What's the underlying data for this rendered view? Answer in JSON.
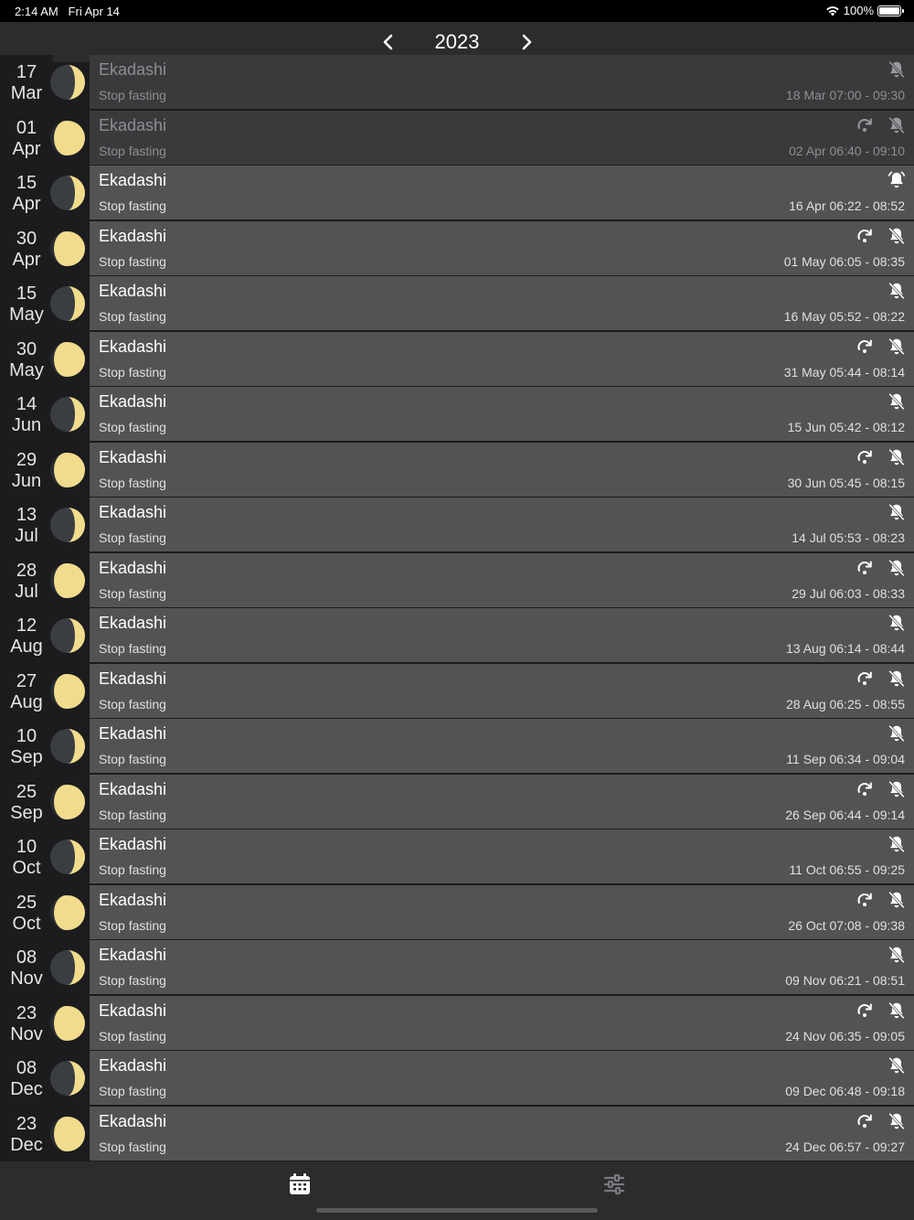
{
  "status_bar": {
    "time": "2:14 AM",
    "date": "Fri Apr 14",
    "battery": "100%"
  },
  "nav": {
    "year": "2023",
    "prev_icon": "chevron-left-icon",
    "next_icon": "chevron-right-icon"
  },
  "events": [
    {
      "day": "17",
      "month": "Mar",
      "title": "Ekadashi",
      "subtitle": "Stop fasting",
      "time": "18 Mar 07:00 - 09:30",
      "moon": "waxing",
      "past": true,
      "repeat": false,
      "bell": "off"
    },
    {
      "day": "01",
      "month": "Apr",
      "title": "Ekadashi",
      "subtitle": "Stop fasting",
      "time": "02 Apr 06:40 - 09:10",
      "moon": "full",
      "past": true,
      "repeat": true,
      "bell": "off"
    },
    {
      "day": "15",
      "month": "Apr",
      "title": "Ekadashi",
      "subtitle": "Stop fasting",
      "time": "16 Apr 06:22 - 08:52",
      "moon": "waxing",
      "past": false,
      "repeat": false,
      "bell": "on"
    },
    {
      "day": "30",
      "month": "Apr",
      "title": "Ekadashi",
      "subtitle": "Stop fasting",
      "time": "01 May 06:05 - 08:35",
      "moon": "full",
      "past": false,
      "repeat": true,
      "bell": "off"
    },
    {
      "day": "15",
      "month": "May",
      "title": "Ekadashi",
      "subtitle": "Stop fasting",
      "time": "16 May 05:52 - 08:22",
      "moon": "waxing",
      "past": false,
      "repeat": false,
      "bell": "off"
    },
    {
      "day": "30",
      "month": "May",
      "title": "Ekadashi",
      "subtitle": "Stop fasting",
      "time": "31 May 05:44 - 08:14",
      "moon": "full",
      "past": false,
      "repeat": true,
      "bell": "off"
    },
    {
      "day": "14",
      "month": "Jun",
      "title": "Ekadashi",
      "subtitle": "Stop fasting",
      "time": "15 Jun 05:42 - 08:12",
      "moon": "waxing",
      "past": false,
      "repeat": false,
      "bell": "off"
    },
    {
      "day": "29",
      "month": "Jun",
      "title": "Ekadashi",
      "subtitle": "Stop fasting",
      "time": "30 Jun 05:45 - 08:15",
      "moon": "full",
      "past": false,
      "repeat": true,
      "bell": "off"
    },
    {
      "day": "13",
      "month": "Jul",
      "title": "Ekadashi",
      "subtitle": "Stop fasting",
      "time": "14 Jul 05:53 - 08:23",
      "moon": "waxing",
      "past": false,
      "repeat": false,
      "bell": "off"
    },
    {
      "day": "28",
      "month": "Jul",
      "title": "Ekadashi",
      "subtitle": "Stop fasting",
      "time": "29 Jul 06:03 - 08:33",
      "moon": "full",
      "past": false,
      "repeat": true,
      "bell": "off"
    },
    {
      "day": "12",
      "month": "Aug",
      "title": "Ekadashi",
      "subtitle": "Stop fasting",
      "time": "13 Aug 06:14 - 08:44",
      "moon": "waxing",
      "past": false,
      "repeat": false,
      "bell": "off"
    },
    {
      "day": "27",
      "month": "Aug",
      "title": "Ekadashi",
      "subtitle": "Stop fasting",
      "time": "28 Aug 06:25 - 08:55",
      "moon": "full",
      "past": false,
      "repeat": true,
      "bell": "off"
    },
    {
      "day": "10",
      "month": "Sep",
      "title": "Ekadashi",
      "subtitle": "Stop fasting",
      "time": "11 Sep 06:34 - 09:04",
      "moon": "waxing",
      "past": false,
      "repeat": false,
      "bell": "off"
    },
    {
      "day": "25",
      "month": "Sep",
      "title": "Ekadashi",
      "subtitle": "Stop fasting",
      "time": "26 Sep 06:44 - 09:14",
      "moon": "full",
      "past": false,
      "repeat": true,
      "bell": "off"
    },
    {
      "day": "10",
      "month": "Oct",
      "title": "Ekadashi",
      "subtitle": "Stop fasting",
      "time": "11 Oct 06:55 - 09:25",
      "moon": "waxing",
      "past": false,
      "repeat": false,
      "bell": "off"
    },
    {
      "day": "25",
      "month": "Oct",
      "title": "Ekadashi",
      "subtitle": "Stop fasting",
      "time": "26 Oct 07:08 - 09:38",
      "moon": "full",
      "past": false,
      "repeat": true,
      "bell": "off"
    },
    {
      "day": "08",
      "month": "Nov",
      "title": "Ekadashi",
      "subtitle": "Stop fasting",
      "time": "09 Nov 06:21 - 08:51",
      "moon": "waxing",
      "past": false,
      "repeat": false,
      "bell": "off"
    },
    {
      "day": "23",
      "month": "Nov",
      "title": "Ekadashi",
      "subtitle": "Stop fasting",
      "time": "24 Nov 06:35 - 09:05",
      "moon": "full",
      "past": false,
      "repeat": true,
      "bell": "off"
    },
    {
      "day": "08",
      "month": "Dec",
      "title": "Ekadashi",
      "subtitle": "Stop fasting",
      "time": "09 Dec 06:48 - 09:18",
      "moon": "waxing",
      "past": false,
      "repeat": false,
      "bell": "off"
    },
    {
      "day": "23",
      "month": "Dec",
      "title": "Ekadashi",
      "subtitle": "Stop fasting",
      "time": "24 Dec 06:57 - 09:27",
      "moon": "full",
      "past": false,
      "repeat": true,
      "bell": "off"
    }
  ],
  "tabs": [
    {
      "name": "calendar",
      "icon": "calendar-icon",
      "active": true
    },
    {
      "name": "settings",
      "icon": "sliders-icon",
      "active": false
    }
  ],
  "colors": {
    "moon_light": "#f1dc8e",
    "moon_dark": "#3a3d42",
    "card": "#535353",
    "card_past": "#3a3a3c"
  }
}
